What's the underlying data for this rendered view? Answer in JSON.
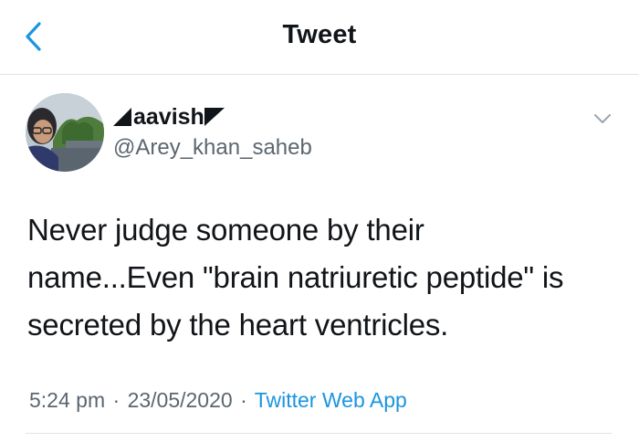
{
  "header": {
    "back_icon": "chevron-left-icon",
    "title": "Tweet"
  },
  "tweet": {
    "author": {
      "display_name": "aavish",
      "handle": "@Arey_khan_saheb"
    },
    "text_lines": [
      "Never judge someone by their",
      "name...Even \"brain natriuretic peptide\" is",
      "secreted by the heart ventricles."
    ],
    "time": "5:24 pm",
    "date": "23/05/2020",
    "separator": "·",
    "source": "Twitter Web App",
    "menu_icon": "chevron-down-icon"
  },
  "colors": {
    "accent": "#1b95e0",
    "text": "#111418",
    "secondary_text": "#5b6670",
    "divider": "#dfe3e8"
  }
}
